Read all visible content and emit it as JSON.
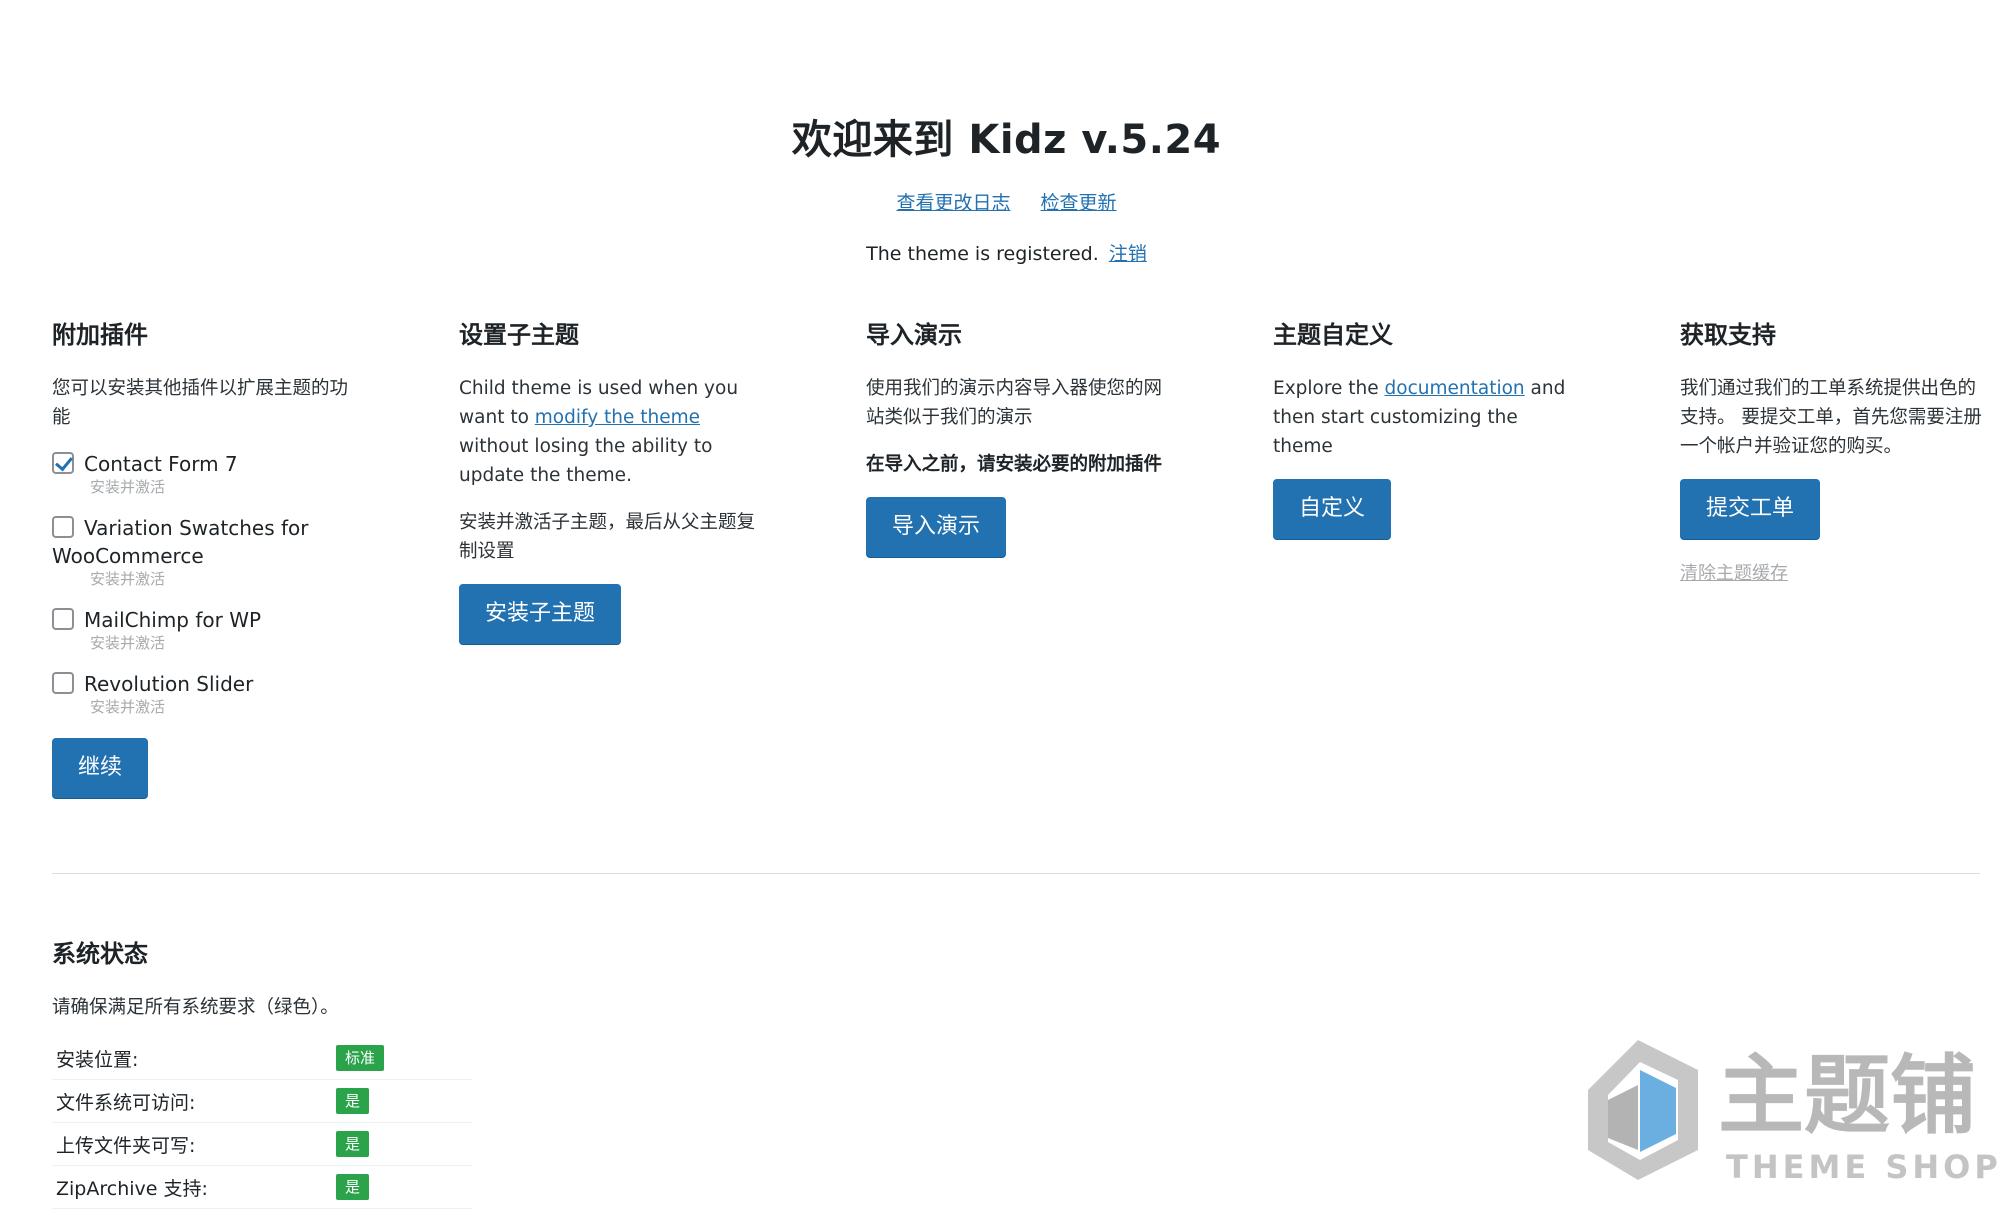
{
  "header": {
    "title": "欢迎来到 Kidz v.5.24",
    "changelog_link": "查看更改日志",
    "update_link": "检查更新",
    "registered_text": "The theme is registered.",
    "deregister_link": "注销"
  },
  "plugins_col": {
    "heading": "附加插件",
    "desc": "您可以安装其他插件以扩展主题的功能",
    "items": [
      {
        "name": "Contact Form 7",
        "sub": "安装并激活",
        "checked": true
      },
      {
        "name": "Variation Swatches for WooCommerce",
        "sub": "安装并激活",
        "checked": false
      },
      {
        "name": "MailChimp for WP",
        "sub": "安装并激活",
        "checked": false
      },
      {
        "name": "Revolution Slider",
        "sub": "安装并激活",
        "checked": false
      }
    ],
    "button": "继续"
  },
  "child_col": {
    "heading": "设置子主题",
    "desc_pre": "Child theme is used when you want to ",
    "desc_link": "modify the theme",
    "desc_post": " without losing the ability to update the theme.",
    "desc2": "安装并激活子主题，最后从父主题复制设置",
    "button": "安装子主题"
  },
  "demo_col": {
    "heading": "导入演示",
    "desc": "使用我们的演示内容导入器使您的网站类似于我们的演示",
    "note": "在导入之前，请安装必要的附加插件",
    "button": "导入演示"
  },
  "customize_col": {
    "heading": "主题自定义",
    "desc_pre": "Explore the ",
    "desc_link": "documentation",
    "desc_post": " and then start customizing the theme",
    "button": "自定义"
  },
  "support_col": {
    "heading": "获取支持",
    "desc": "我们通过我们的工单系统提供出色的支持。 要提交工单，首先您需要注册一个帐户并验证您的购买。",
    "button": "提交工单",
    "clear_cache_link": "清除主题缓存"
  },
  "system_status": {
    "heading": "系统状态",
    "desc": "请确保满足所有系统要求（绿色）。",
    "rows": [
      {
        "label": "安装位置:",
        "value": "标准"
      },
      {
        "label": "文件系统可访问:",
        "value": "是"
      },
      {
        "label": "上传文件夹可写:",
        "value": "是"
      },
      {
        "label": "ZipArchive 支持:",
        "value": "是"
      }
    ]
  },
  "watermark": {
    "cn_text": "主题铺",
    "en_text": "THEME SHOP"
  },
  "colors": {
    "primary": "#2271b1",
    "badge_green": "#2aa34a"
  }
}
